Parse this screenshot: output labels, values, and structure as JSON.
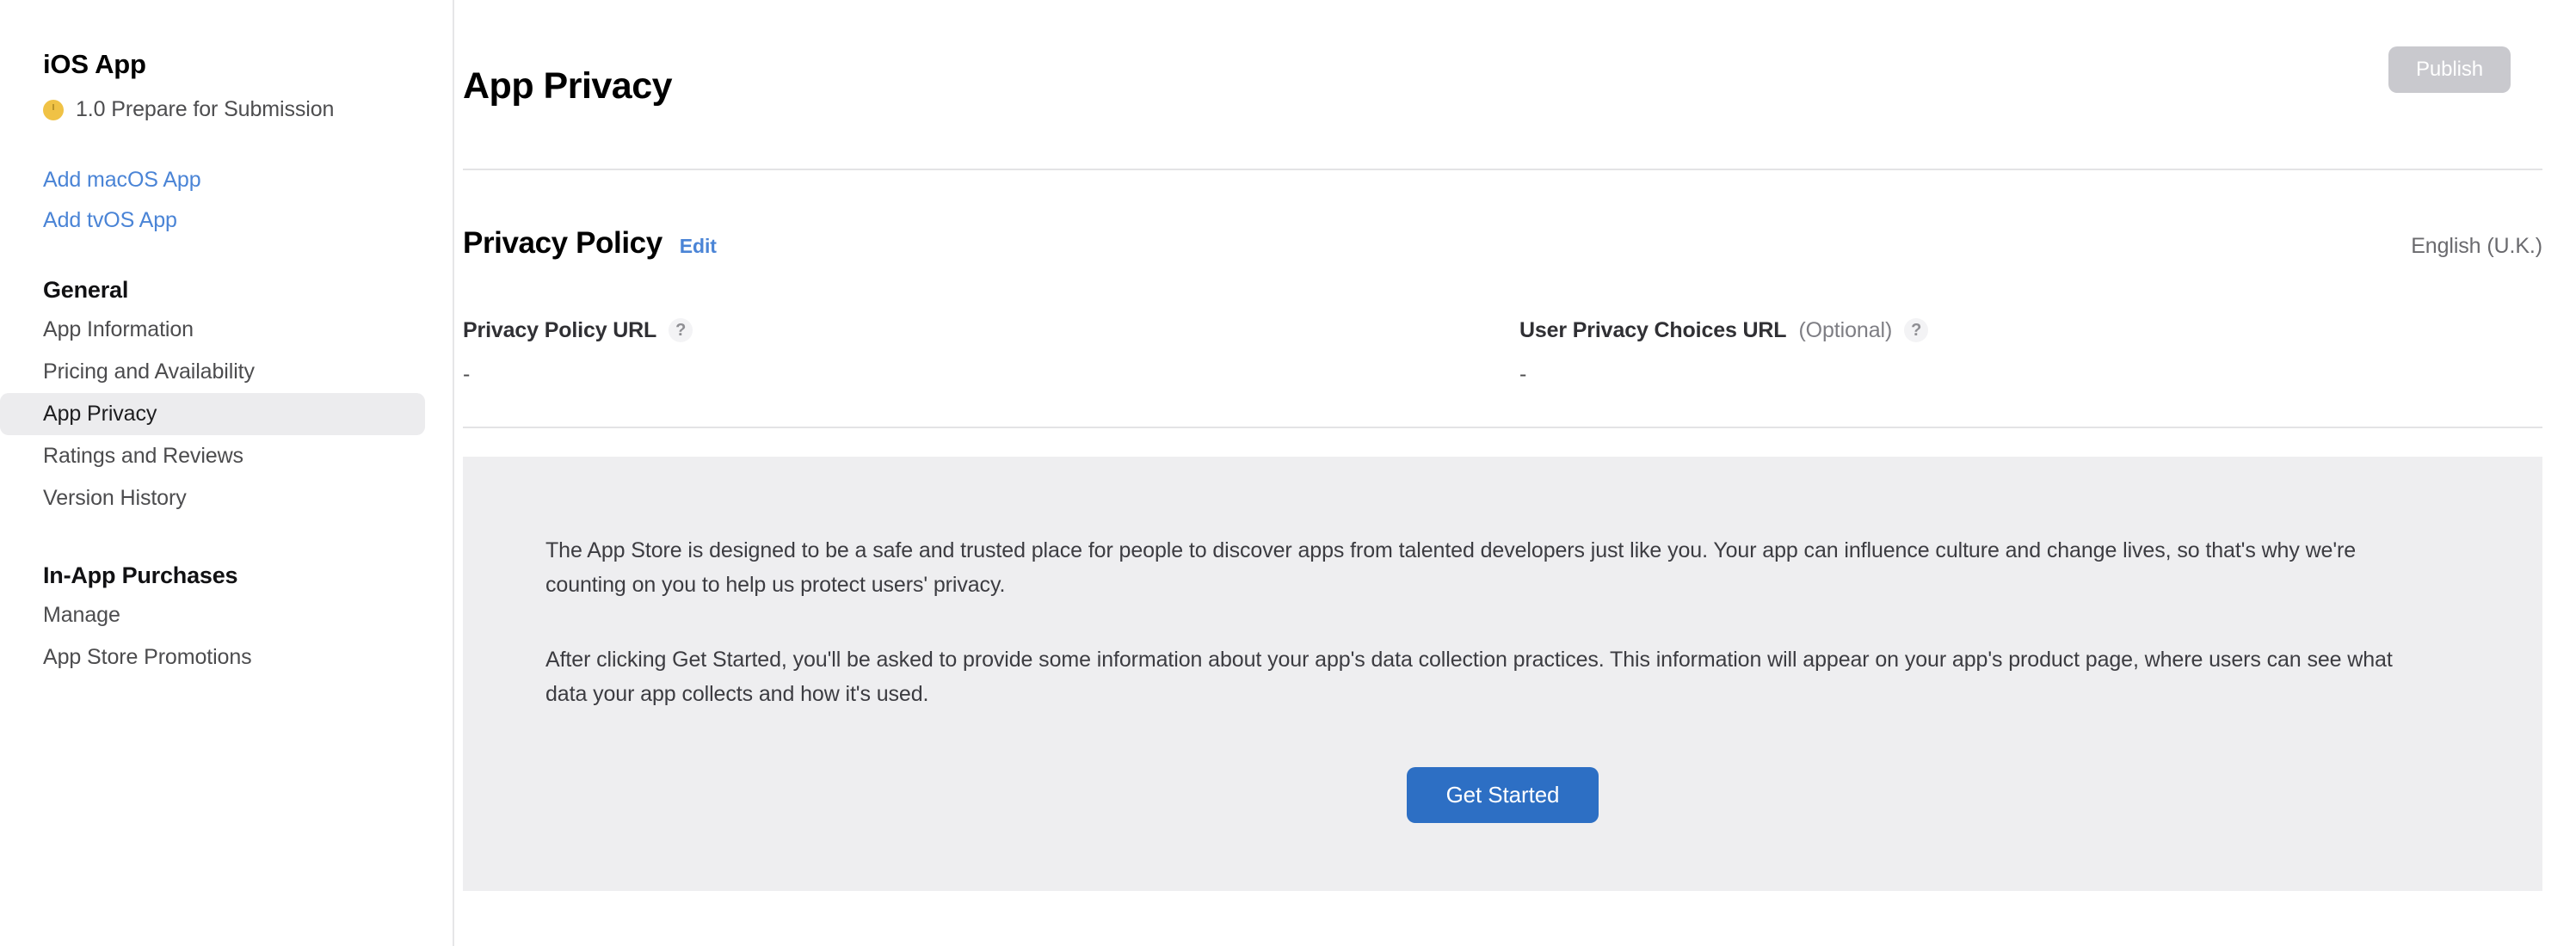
{
  "sidebar": {
    "app_title": "iOS App",
    "version_status": "1.0 Prepare for Submission",
    "status_dot_color": "#f0c245",
    "platform_links": [
      {
        "label": "Add macOS App"
      },
      {
        "label": "Add tvOS App"
      }
    ],
    "sections": [
      {
        "title": "General",
        "items": [
          {
            "label": "App Information",
            "selected": false
          },
          {
            "label": "Pricing and Availability",
            "selected": false
          },
          {
            "label": "App Privacy",
            "selected": true
          },
          {
            "label": "Ratings and Reviews",
            "selected": false
          },
          {
            "label": "Version History",
            "selected": false
          }
        ]
      },
      {
        "title": "In-App Purchases",
        "items": [
          {
            "label": "Manage",
            "selected": false
          },
          {
            "label": "App Store Promotions",
            "selected": false
          }
        ]
      }
    ]
  },
  "header": {
    "title": "App Privacy",
    "publish_label": "Publish",
    "publish_disabled_color": "#c9c9ce"
  },
  "privacy_policy": {
    "title": "Privacy Policy",
    "edit_label": "Edit",
    "language": "English (U.K.)",
    "link_color": "#4a84d6",
    "fields": [
      {
        "label": "Privacy Policy URL",
        "optional": "",
        "help_icon": "question-mark-icon",
        "value": "-"
      },
      {
        "label": "User Privacy Choices URL",
        "optional": "(Optional)",
        "help_icon": "question-mark-icon",
        "value": "-"
      }
    ]
  },
  "info_panel": {
    "paragraph_1": "The App Store is designed to be a safe and trusted place for people to discover apps from talented developers just like you. Your app can influence culture and change lives, so that's why we're counting on you to help us protect users' privacy.",
    "paragraph_2": "After clicking Get Started, you'll be asked to provide some information about your app's data collection practices. This information will appear on your app's product page, where users can see what data your app collects and how it's used.",
    "get_started_label": "Get Started",
    "accent_color": "#2d6fc4",
    "background_color": "#eeeef0"
  }
}
